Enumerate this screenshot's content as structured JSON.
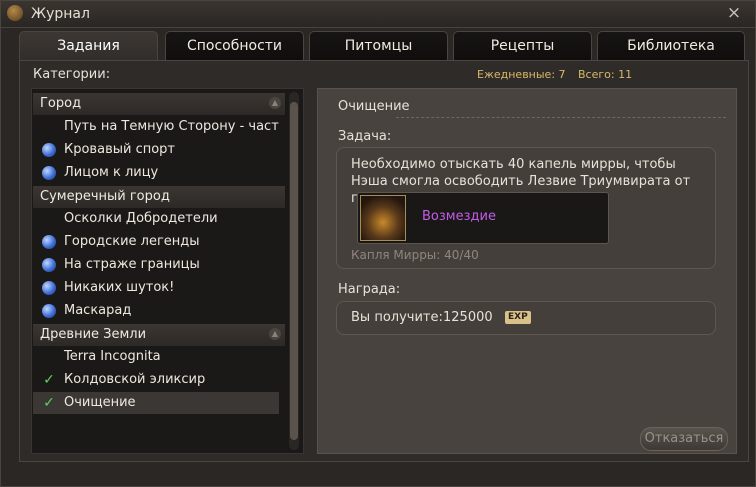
{
  "window": {
    "title": "Журнал",
    "close_label": "×"
  },
  "tabs": [
    {
      "label": "Задания",
      "active": true
    },
    {
      "label": "Способности"
    },
    {
      "label": "Питомцы"
    },
    {
      "label": "Рецепты"
    },
    {
      "label": "Библиотека"
    }
  ],
  "categories": {
    "label": "Категории:",
    "daily": "Ежедневные: 7",
    "total": "Всего: 11"
  },
  "quest_list": {
    "groups": [
      {
        "title": "Город",
        "items": [
          {
            "label": "Путь на Темную Сторону - часть |",
            "icon": "none"
          },
          {
            "label": "Кровавый спорт",
            "icon": "swirl-icon"
          },
          {
            "label": "Лицом к лицу",
            "icon": "swirl-icon"
          }
        ]
      },
      {
        "title": "Сумеречный город",
        "items": [
          {
            "label": "Осколки Добродетели",
            "icon": "none"
          },
          {
            "label": "Городские легенды",
            "icon": "swirl-icon"
          },
          {
            "label": "На страже границы",
            "icon": "swirl-icon"
          },
          {
            "label": "Никаких шуток!",
            "icon": "swirl-icon"
          },
          {
            "label": "Маскарад",
            "icon": "swirl-icon"
          }
        ]
      },
      {
        "title": "Древние Земли",
        "items": [
          {
            "label": "Terra Incognita",
            "icon": "none"
          },
          {
            "label": "Колдовской эликсир",
            "icon": "check-icon"
          },
          {
            "label": "Очищение",
            "icon": "check-icon",
            "selected": true
          }
        ]
      }
    ]
  },
  "detail": {
    "title": "Очищение",
    "task_label": "Задача:",
    "task_text": "Необходимо отыскать 40 капель мирры, чтобы Нэша смогла освободить Лезвие Триумвирата от проклятья.",
    "item_name": "Возмездие",
    "progress": "Капля Мирры: 40/40",
    "reward_label": "Награда:",
    "reward_prefix": "Вы получите:",
    "reward_value": "125000",
    "reward_unit": "EXP",
    "refuse_button": "Отказаться"
  },
  "colors": {
    "item_name": "#c35ce8",
    "counter": "#d8b96a",
    "check": "#5cd35a"
  }
}
